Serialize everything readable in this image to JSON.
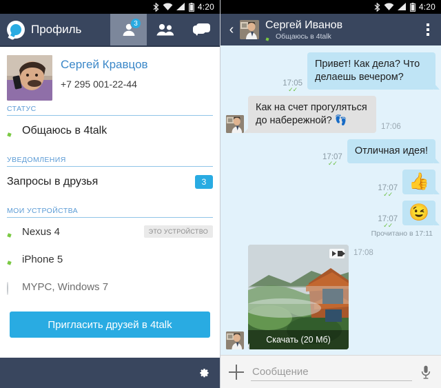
{
  "status_bar": {
    "time": "4:20",
    "icons": [
      "bluetooth-icon",
      "wifi-icon",
      "signal-icon",
      "battery-icon"
    ]
  },
  "left_panel": {
    "header": {
      "logo_icon": "4talk-logo-icon",
      "title": "Профиль",
      "tabs": [
        {
          "name": "tab-profile",
          "icon": "person-icon",
          "badge": "3",
          "active": true
        },
        {
          "name": "tab-contacts",
          "icon": "people-icon",
          "badge": "",
          "active": false
        },
        {
          "name": "tab-chats",
          "icon": "chat-bubbles-icon",
          "badge": "",
          "active": false
        }
      ]
    },
    "profile": {
      "avatar": "user-photo",
      "name": "Сергей Кравцов",
      "phone": "+7 295 001-22-44"
    },
    "status_section": {
      "title": "СТАТУС",
      "value": "Общаюсь в 4talk",
      "online": true
    },
    "notifications_section": {
      "title": "УВЕДОМЛЕНИЯ",
      "items": [
        {
          "label": "Запросы в друзья",
          "badge": "3"
        }
      ]
    },
    "devices_section": {
      "title": "МОИ УСТРОЙСТВА",
      "items": [
        {
          "label": "Nexus 4",
          "online": true,
          "badge": "ЭТО УСТРОЙСТВО"
        },
        {
          "label": "iPhone 5",
          "online": true,
          "badge": ""
        },
        {
          "label": "MYPC, Windows 7",
          "online": false,
          "badge": ""
        }
      ]
    },
    "invite_button": "Пригласить друзей в 4talk",
    "bottom_bar": {
      "settings_icon": "gear-icon"
    }
  },
  "right_panel": {
    "header": {
      "back_icon": "back-chevron-icon",
      "avatar": "contact-photo",
      "name": "Сергей Иванов",
      "status": "Общаюсь в 4talk",
      "online": true,
      "menu_icon": "overflow-menu-icon"
    },
    "messages": [
      {
        "id": "m1",
        "dir": "out",
        "type": "text",
        "text": "Привет! Как дела? Что делаешь вечером?",
        "time": "17:05",
        "ticks": true
      },
      {
        "id": "m2",
        "dir": "in",
        "type": "text",
        "text": "Как на счет прогуляться до набережной? 👣",
        "time": "17:06",
        "ticks": false
      },
      {
        "id": "m3",
        "dir": "out",
        "type": "text",
        "text": "Отличная идея!",
        "time": "17:07",
        "ticks": true
      },
      {
        "id": "m4",
        "dir": "out",
        "type": "emoji",
        "text": "👍",
        "time": "17:07",
        "ticks": true
      },
      {
        "id": "m5",
        "dir": "out",
        "type": "emoji",
        "text": "😉",
        "time": "17:07",
        "ticks": true
      },
      {
        "id": "m6",
        "dir": "in",
        "type": "video",
        "caption": "Скачать (20 Мб)",
        "time": "17:08",
        "ticks": false
      }
    ],
    "read_receipt": "Прочитано в 17:11",
    "composer": {
      "attach_icon": "plus-icon",
      "input_value": "",
      "input_placeholder": "Сообщение",
      "mic_icon": "microphone-icon"
    }
  },
  "colors": {
    "header_navy": "#39465e",
    "accent_blue": "#29abe2",
    "chat_bg": "#e2f2fb",
    "bubble_out": "#bfe4f5",
    "bubble_in": "#e1e1e1",
    "online_green": "#7ac943",
    "link_blue": "#3a87c8"
  }
}
